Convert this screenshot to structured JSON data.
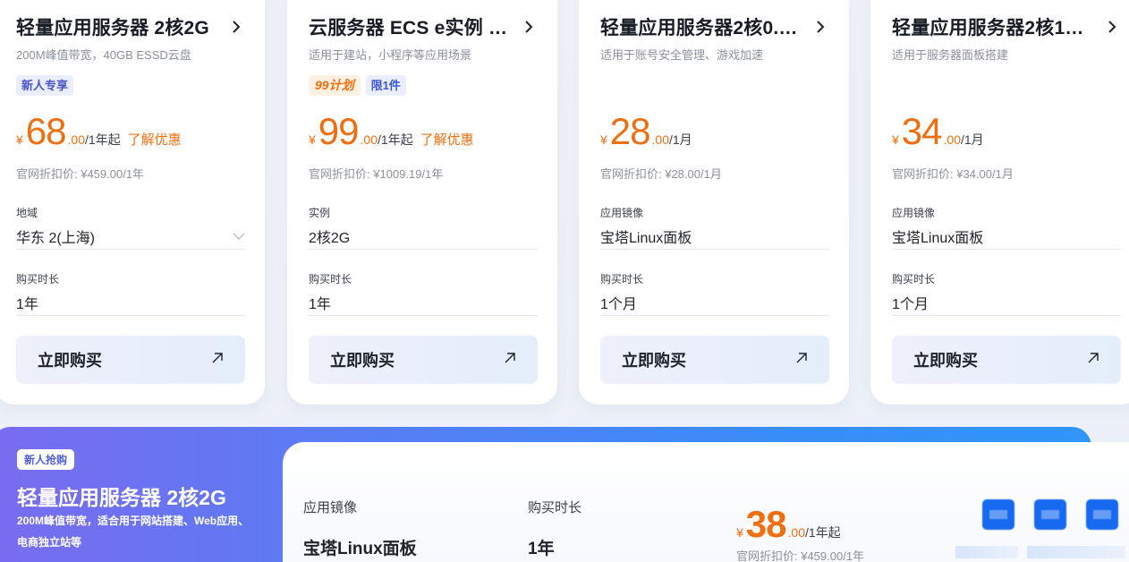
{
  "cards": [
    {
      "title": "轻量应用服务器 2核2G",
      "subtitle": "200M峰值带宽，40GB ESSD云盘",
      "tags": [
        "新人专享"
      ],
      "currency": "¥",
      "price_int": "68",
      "price_dec": ".00",
      "price_unit": "/1年起",
      "promo": "了解优惠",
      "orig_price": "官网折扣价: ¥459.00/1年",
      "field1_label": "地域",
      "field1_value": "华东 2(上海)",
      "field2_label": "购买时长",
      "field2_value": "1年",
      "buy_label": "立即购买"
    },
    {
      "title": "云服务器 ECS e实例 …",
      "subtitle": "适用于建站，小程序等应用场景",
      "tags": [
        "99计划",
        "限1件"
      ],
      "currency": "¥",
      "price_int": "99",
      "price_dec": ".00",
      "price_unit": "/1年起",
      "promo": "了解优惠",
      "orig_price": "官网折扣价: ¥1009.19/1年",
      "field1_label": "实例",
      "field1_value": "2核2G",
      "field2_label": "购买时长",
      "field2_value": "1年",
      "buy_label": "立即购买"
    },
    {
      "title": "轻量应用服务器2核0.…",
      "subtitle": "适用于账号安全管理、游戏加速",
      "tags": [],
      "currency": "¥",
      "price_int": "28",
      "price_dec": ".00",
      "price_unit": "/1月",
      "promo": "",
      "orig_price": "官网折扣价: ¥28.00/1月",
      "field1_label": "应用镜像",
      "field1_value": "宝塔Linux面板",
      "field2_label": "购买时长",
      "field2_value": "1个月",
      "buy_label": "立即购买"
    },
    {
      "title": "轻量应用服务器2核1…",
      "subtitle": "适用于服务器面板搭建",
      "tags": [],
      "currency": "¥",
      "price_int": "34",
      "price_dec": ".00",
      "price_unit": "/1月",
      "promo": "",
      "orig_price": "官网折扣价: ¥34.00/1月",
      "field1_label": "应用镜像",
      "field1_value": "宝塔Linux面板",
      "field2_label": "购买时长",
      "field2_value": "1个月",
      "buy_label": "立即购买"
    }
  ],
  "banner": {
    "tag": "新人抢购",
    "title": "轻量应用服务器 2核2G",
    "desc": "200M峰值带宽，适合用于网站搭建、Web应用、电商独立站等",
    "image_label": "应用镜像",
    "image_value": "宝塔Linux面板",
    "duration_label": "购买时长",
    "duration_value": "1年",
    "currency": "¥",
    "price_int": "38",
    "price_dec": ".00",
    "price_unit": "/1年起",
    "orig_price": "官网折扣价: ¥459.00/1年"
  },
  "colors": {
    "accent_orange": "#ee6f11",
    "banner_blue": "#3a8cf7",
    "button_blue": "#1769f0"
  },
  "icons": {
    "title_arrow": "chevron-right-icon",
    "dropdown": "chevron-down-icon",
    "buy_arrow": "arrow-up-right-icon"
  }
}
